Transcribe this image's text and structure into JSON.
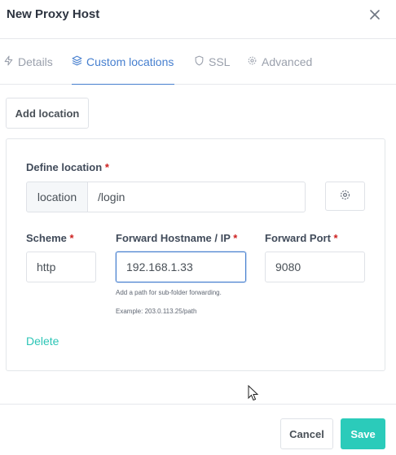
{
  "modal": {
    "title": "New Proxy Host"
  },
  "tabs": [
    {
      "label": "Details",
      "icon": "zap-icon"
    },
    {
      "label": "Custom locations",
      "icon": "layers-icon"
    },
    {
      "label": "SSL",
      "icon": "shield-icon"
    },
    {
      "label": "Advanced",
      "icon": "gear-icon"
    }
  ],
  "active_tab": "Custom locations",
  "add_location_label": "Add location",
  "location": {
    "define_label": "Define location",
    "required_mark": "*",
    "addon": "location",
    "path_value": "/login",
    "settings_icon": "gear-icon",
    "scheme_label": "Scheme",
    "scheme_value": "http",
    "hostname_label": "Forward Hostname / IP",
    "hostname_value": "192.168.1.33",
    "port_label": "Forward Port",
    "port_value": "9080",
    "help_line1": "Add a path for sub-folder forwarding.",
    "help_line2": "Example: 203.0.113.25/path",
    "delete_label": "Delete"
  },
  "footer": {
    "cancel_label": "Cancel",
    "save_label": "Save"
  },
  "colors": {
    "accent": "#467fcf",
    "teal": "#2bcbba",
    "required": "#cd201f"
  }
}
